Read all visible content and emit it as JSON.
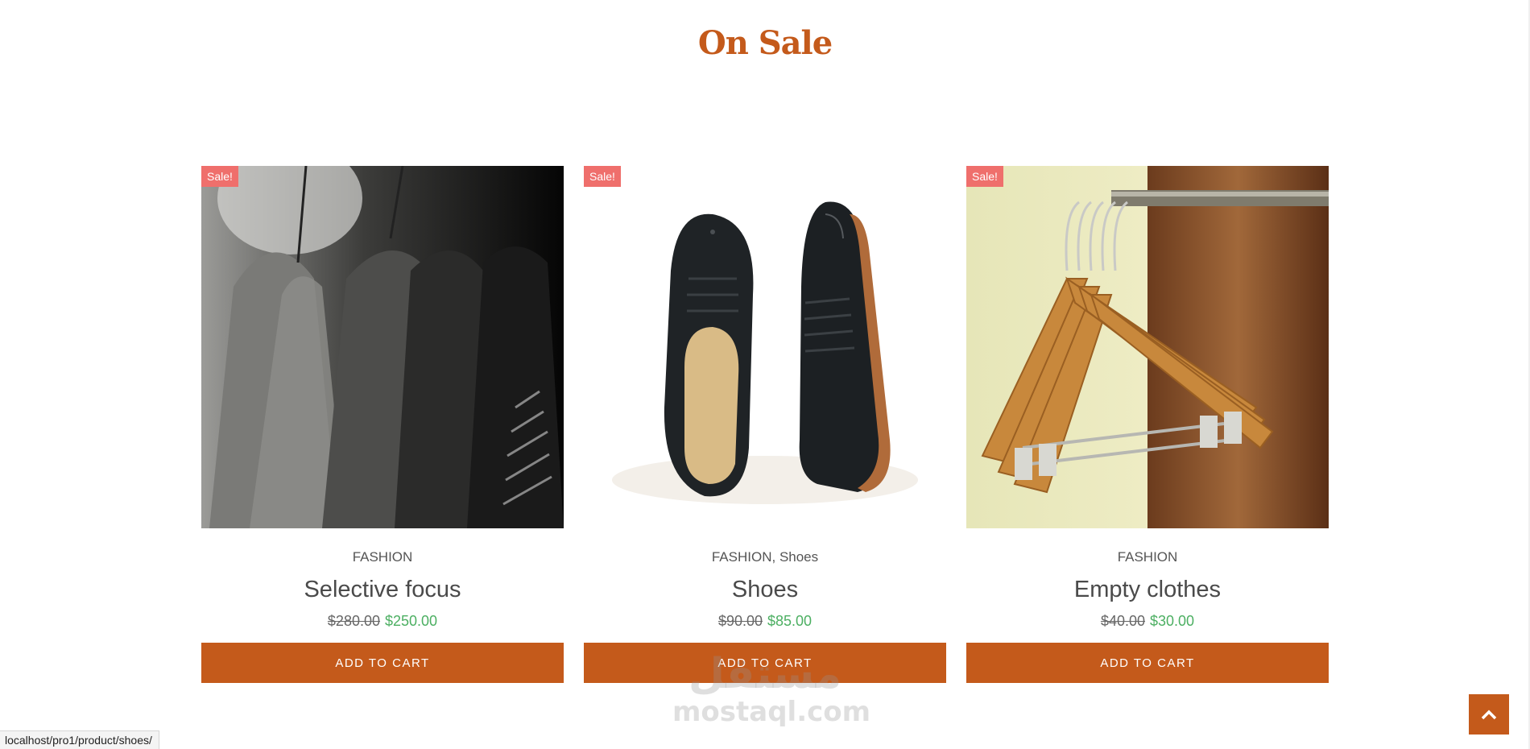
{
  "section": {
    "title": "On Sale"
  },
  "products": [
    {
      "badge": "Sale!",
      "categories": [
        "FASHION"
      ],
      "title": "Selective focus",
      "price_old": "$280.00",
      "price_new": "$250.00",
      "button": "ADD TO CART"
    },
    {
      "badge": "Sale!",
      "categories": [
        "FASHION",
        "Shoes"
      ],
      "category_separator": ",",
      "title": "Shoes",
      "price_old": "$90.00",
      "price_new": "$85.00",
      "button": "ADD TO CART"
    },
    {
      "badge": "Sale!",
      "categories": [
        "FASHION"
      ],
      "title": "Empty clothes",
      "price_old": "$40.00",
      "price_new": "$30.00",
      "button": "ADD TO CART"
    }
  ],
  "status_bar": {
    "url": "localhost/pro1/product/shoes/"
  },
  "watermark": {
    "arabic": "مستقل",
    "latin": "mostaql.com"
  },
  "back_to_top": {
    "icon": "chevron-up-icon"
  },
  "colors": {
    "accent": "#c45a1b",
    "sale_badge": "#ef6f6c",
    "price_new": "#4caf62"
  }
}
